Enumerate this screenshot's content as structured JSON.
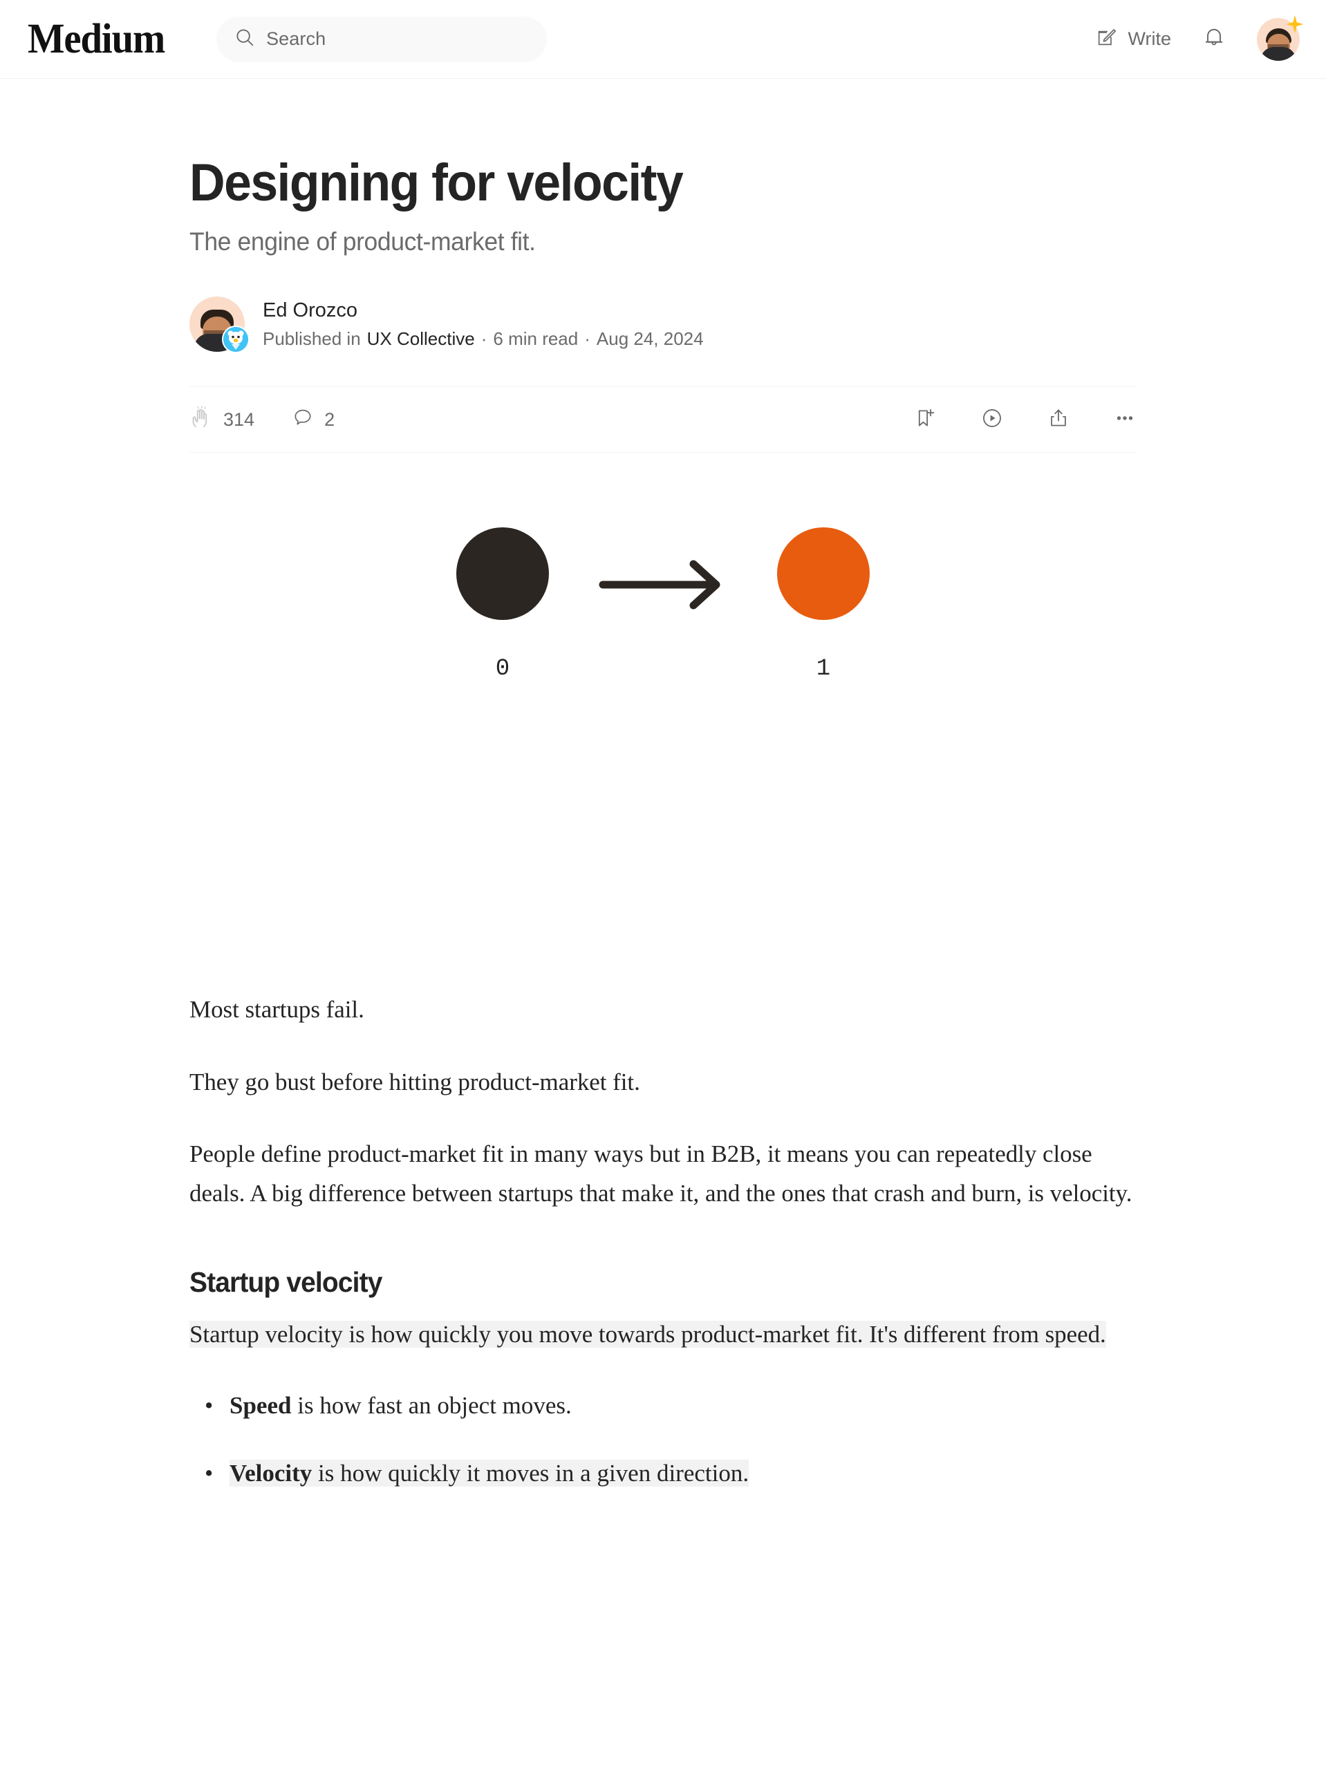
{
  "header": {
    "brand": "Medium",
    "search": {
      "placeholder": "Search",
      "icon": "search-icon"
    },
    "write_label": "Write",
    "write_icon": "write-pencil-icon",
    "notifications_icon": "bell-icon",
    "avatar_icon": "user-avatar",
    "star_badge_icon": "star-icon",
    "star_color": "#ffc017"
  },
  "article": {
    "title": "Designing for velocity",
    "subtitle": "The engine of product-market fit.",
    "author": "Ed Orozco",
    "published_in_prefix": "Published in",
    "publication": "UX Collective",
    "read_time": "6 min read",
    "date": "Aug 24, 2024",
    "separator": "·"
  },
  "actions": {
    "claps": "314",
    "clap_icon": "clap-icon",
    "comments": "2",
    "comment_icon": "comment-bubble-icon",
    "bookmark_icon": "bookmark-add-icon",
    "listen_icon": "play-circle-icon",
    "share_icon": "share-upload-icon",
    "more_icon": "ellipsis-icon"
  },
  "hero": {
    "left_label": "0",
    "right_label": "1",
    "left_color": "#2b2621",
    "right_color": "#e85c10",
    "arrow_icon": "arrow-right-icon"
  },
  "body": {
    "p1": "Most startups fail.",
    "p2": "They go bust before hitting product-market fit.",
    "p3": "People define product-market fit in many ways but in B2B, it means you can repeatedly close deals. A big difference between startups that make it, and the ones that crash and burn, is velocity.",
    "h2": "Startup velocity",
    "p4": "Startup velocity is how quickly you move towards product-market fit. It's different from speed.",
    "bullet1_bold": "Speed",
    "bullet1_rest": " is how fast an object moves.",
    "bullet2_bold": "Velocity",
    "bullet2_rest": " is how quickly it moves in a given direction."
  },
  "colors": {
    "text": "#242424",
    "muted": "#6b6b6b",
    "highlight": "#f2f2f2",
    "accent_orange": "#e85c10"
  }
}
